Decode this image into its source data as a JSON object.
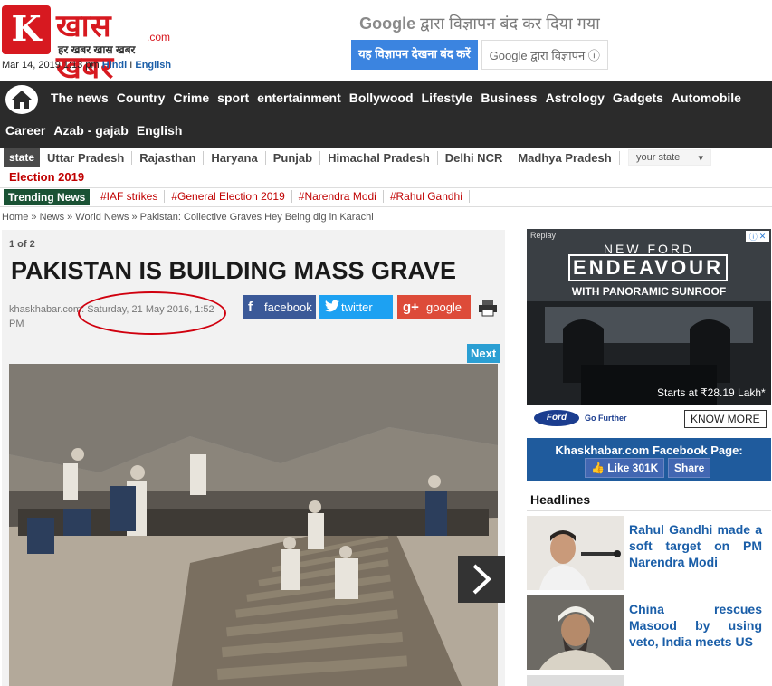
{
  "header": {
    "logo_mark": "K",
    "logo_title": "खास खबर",
    "logo_dotcom": ".com",
    "logo_tagline": "हर खबर खास खबर",
    "date": "Mar 14, 2019 1:13 pm",
    "lang_hindi": "Hindi",
    "lang_sep": "I",
    "lang_english": "English"
  },
  "ad_notice": {
    "google": "Google",
    "title": "द्वारा विज्ञापन बंद कर दिया गया",
    "stop_button": "यह विज्ञापन देखना बंद करें",
    "info_button": "Google द्वारा विज्ञापन ⓘ"
  },
  "nav": {
    "row1": [
      "The news",
      "Country",
      "Crime",
      "sport",
      "entertainment",
      "Bollywood",
      "Lifestyle",
      "Business",
      "Astrology",
      "Gadgets",
      "Automobile"
    ],
    "row2": [
      "Career",
      "Azab - gajab",
      "English"
    ]
  },
  "states": {
    "label": "state",
    "items": [
      "Uttar Pradesh",
      "Rajasthan",
      "Haryana",
      "Punjab",
      "Himachal Pradesh",
      "Delhi NCR",
      "Madhya Pradesh"
    ],
    "select_value": "your state",
    "election": "Election 2019"
  },
  "trending": {
    "label": "Trending News",
    "items": [
      "#IAF strikes",
      "#General Election 2019",
      "#Narendra Modi",
      "#Rahul Gandhi"
    ]
  },
  "breadcrumb": "Home » News » World News » Pakistan: Collective Graves Hey Being dig in Karachi",
  "article": {
    "page_info": "1 of 2",
    "headline": "PAKISTAN IS BUILDING MASS GRAVE",
    "source": "khaskhabar.com",
    "date": ": Saturday, 21 May 2016, 1:52 PM",
    "share_facebook": "facebook",
    "share_twitter": "twitter",
    "share_google": "google",
    "next": "Next"
  },
  "sidebar": {
    "ad": {
      "replay": "Replay",
      "line1": "NEW FORD",
      "line2": "ENDEAVOUR",
      "line3": "WITH PANORAMIC SUNROOF",
      "price": "Starts at ₹28.19 Lakh*",
      "brand": "Ford",
      "slogan": "Go Further",
      "cta": "KNOW MORE"
    },
    "facebook_box": {
      "title": "Khaskhabar.com Facebook Page:",
      "like": "Like 301K",
      "share": "Share"
    },
    "headlines_title": "Headlines",
    "headlines": [
      {
        "text": "Rahul Gandhi made a soft target on PM Narendra Modi"
      },
      {
        "text": "China rescues Masood by using veto, India meets US"
      }
    ]
  }
}
